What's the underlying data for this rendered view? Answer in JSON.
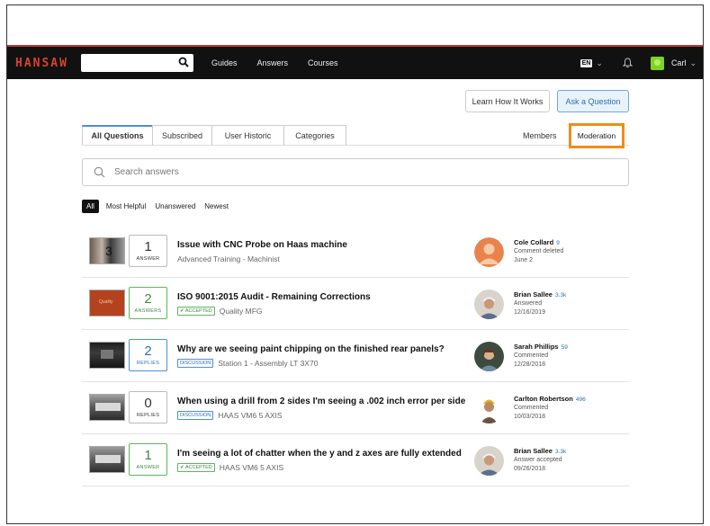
{
  "navbar": {
    "logo": "HANSAW",
    "search_placeholder": "",
    "links": [
      "Guides",
      "Answers",
      "Courses"
    ],
    "language": "EN",
    "user_name": "Carl"
  },
  "actions": {
    "learn_label": "Learn How It Works",
    "ask_label": "Ask a Question"
  },
  "tabs": {
    "items": [
      "All Questions",
      "Subscribed",
      "User Historic",
      "Categories"
    ],
    "members_label": "Members",
    "moderation_label": "Moderation"
  },
  "search": {
    "placeholder": "Search answers"
  },
  "filters": [
    "All",
    "Most Helpful",
    "Unanswered",
    "Newest"
  ],
  "questions": [
    {
      "count": "1",
      "count_label": "ANSWER",
      "count_style": "gray",
      "title": "Issue with CNC Probe on Haas machine",
      "badge": "",
      "meta": "Advanced Training - Machinist",
      "user": "Cole Collard",
      "rep": "9",
      "action": "Comment deleted",
      "date": "June 2",
      "thumb_label": "3"
    },
    {
      "count": "2",
      "count_label": "ANSWERS",
      "count_style": "green",
      "title": "ISO 9001:2015 Audit - Remaining Corrections",
      "badge": "✔ ACCEPTED",
      "meta": "Quality MFG",
      "user": "Brian Sallee",
      "rep": "3.3k",
      "action": "Answered",
      "date": "12/16/2019",
      "thumb_label": "Quality"
    },
    {
      "count": "2",
      "count_label": "REPLIES",
      "count_style": "blue",
      "title": "Why are we seeing paint chipping on the finished rear panels?",
      "badge": "DISCUSSION",
      "meta": "Station 1 - Assembly LT 3X70",
      "user": "Sarah Phillips",
      "rep": "59",
      "action": "Commented",
      "date": "12/28/2018",
      "thumb_label": ""
    },
    {
      "count": "0",
      "count_label": "REPLIES",
      "count_style": "gray",
      "title": "When using a drill from 2 sides I'm seeing a .002 inch error per side",
      "badge": "DISCUSSION",
      "meta": "HAAS VM6 5 AXIS",
      "user": "Carlton Robertson",
      "rep": "496",
      "action": "Commented",
      "date": "10/03/2018",
      "thumb_label": ""
    },
    {
      "count": "1",
      "count_label": "ANSWER",
      "count_style": "green",
      "title": "I'm seeing a lot of chatter when the y and z axes are fully extended",
      "badge": "✔ ACCEPTED",
      "meta": "HAAS VM6 5 AXIS",
      "user": "Brian Sallee",
      "rep": "3.3k",
      "action": "Answer accepted",
      "date": "09/26/2018",
      "thumb_label": ""
    }
  ],
  "colors": {
    "accent": "#4a90d9",
    "moderation_highlight": "#f28c18",
    "accepted": "#5cb85c",
    "logo": "#d9432b"
  }
}
